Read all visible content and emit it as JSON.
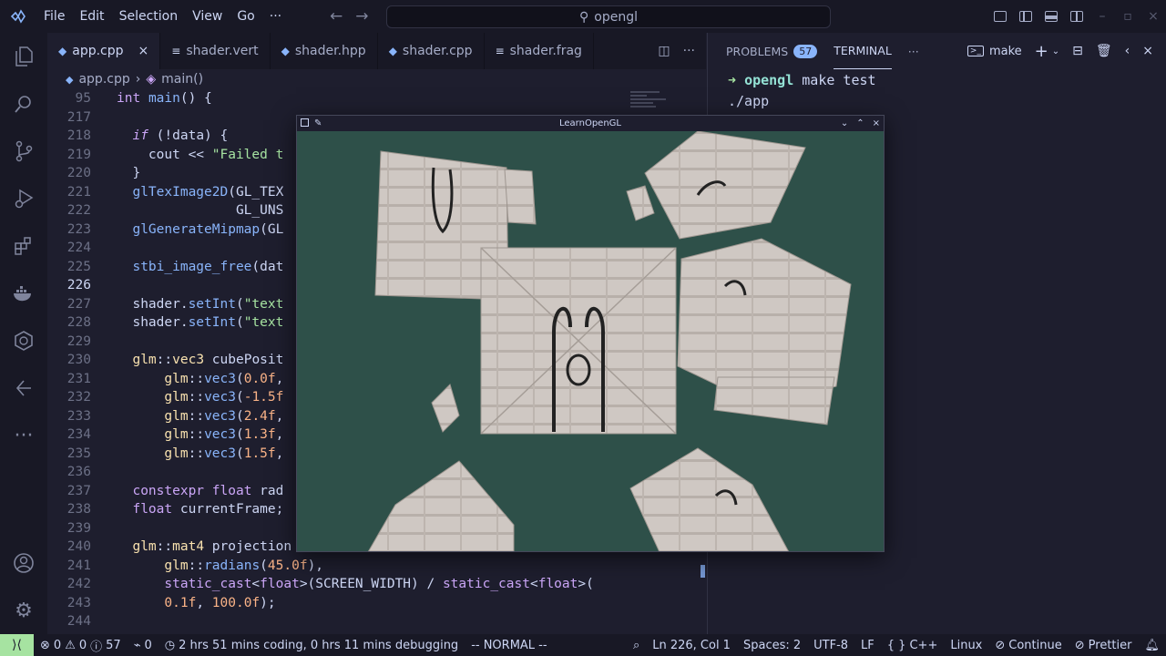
{
  "menu": [
    "File",
    "Edit",
    "Selection",
    "View",
    "Go",
    "···"
  ],
  "search": {
    "text": "opengl"
  },
  "editor": {
    "tabs": [
      {
        "label": "app.cpp",
        "icon": "cpp-icon",
        "active": true
      },
      {
        "label": "shader.vert",
        "icon": "file-lines-icon"
      },
      {
        "label": "shader.hpp",
        "icon": "cpp-icon"
      },
      {
        "label": "shader.cpp",
        "icon": "cpp-icon"
      },
      {
        "label": "shader.frag",
        "icon": "file-lines-icon"
      }
    ],
    "breadcrumb": {
      "file": "app.cpp",
      "symbol": "main()"
    },
    "lines": [
      {
        "n": "95",
        "html": "<span class='kw'>int</span> <span class='fn'>main</span>() {"
      },
      {
        "n": "217",
        "html": ""
      },
      {
        "n": "218",
        "html": "  <span class='it'>if</span> (!data) {"
      },
      {
        "n": "219",
        "html": "    cout << <span class='st'>\"Failed t</span>"
      },
      {
        "n": "220",
        "html": "  }"
      },
      {
        "n": "221",
        "html": "  <span class='fn'>glTexImage2D</span>(GL_TEX"
      },
      {
        "n": "222",
        "html": "               GL_UNS"
      },
      {
        "n": "223",
        "html": "  <span class='fn'>glGenerateMipmap</span>(GL"
      },
      {
        "n": "224",
        "html": ""
      },
      {
        "n": "225",
        "html": "  <span class='fn'>stbi_image_free</span>(dat"
      },
      {
        "n": "226",
        "html": "",
        "current": true
      },
      {
        "n": "227",
        "html": "  shader.<span class='fn'>setInt</span>(<span class='st'>\"text</span>"
      },
      {
        "n": "228",
        "html": "  shader.<span class='fn'>setInt</span>(<span class='st'>\"text</span>"
      },
      {
        "n": "229",
        "html": ""
      },
      {
        "n": "230",
        "html": "  <span class='ty'>glm</span>::<span class='ty'>vec3</span> cubePosit"
      },
      {
        "n": "231",
        "html": "      <span class='ty'>glm</span>::<span class='fn'>vec3</span>(<span class='nm'>0.0f</span>,"
      },
      {
        "n": "232",
        "html": "      <span class='ty'>glm</span>::<span class='fn'>vec3</span>(<span class='nm'>-1.5f</span>"
      },
      {
        "n": "233",
        "html": "      <span class='ty'>glm</span>::<span class='fn'>vec3</span>(<span class='nm'>2.4f</span>,"
      },
      {
        "n": "234",
        "html": "      <span class='ty'>glm</span>::<span class='fn'>vec3</span>(<span class='nm'>1.3f</span>,"
      },
      {
        "n": "235",
        "html": "      <span class='ty'>glm</span>::<span class='fn'>vec3</span>(<span class='nm'>1.5f</span>,"
      },
      {
        "n": "236",
        "html": ""
      },
      {
        "n": "237",
        "html": "  <span class='kw'>constexpr</span> <span class='kw'>float</span> rad"
      },
      {
        "n": "238",
        "html": "  <span class='kw'>float</span> currentFrame;"
      },
      {
        "n": "239",
        "html": ""
      },
      {
        "n": "240",
        "html": "  <span class='ty'>glm</span>::<span class='ty'>mat4</span> projection"
      },
      {
        "n": "241",
        "html": "      <span class='ty'>glm</span>::<span class='fn'>radians</span>(<span class='nm'>45.0f</span>),"
      },
      {
        "n": "242",
        "html": "      <span class='kw'>static_cast</span><<span class='kw'>float</span>>(SCREEN_WIDTH) / <span class='kw'>static_cast</span><<span class='kw'>float</span>>("
      },
      {
        "n": "243",
        "html": "      <span class='nm'>0.1f</span>, <span class='nm'>100.0f</span>);"
      },
      {
        "n": "244",
        "html": ""
      }
    ]
  },
  "panel": {
    "problems_label": "PROBLEMS",
    "problems_count": "57",
    "terminal_label": "TERMINAL",
    "more": "···",
    "shell_name": "make",
    "terminal_lines": [
      {
        "arrow": "➜",
        "dir": "opengl",
        "cmd": "make test"
      },
      {
        "text": "./app"
      }
    ]
  },
  "glwindow": {
    "title": "LearnOpenGL",
    "clear_color": "#2e5049"
  },
  "status": {
    "errors": "0",
    "warnings": "0",
    "info": "57",
    "ports": "0",
    "time": "2 hrs 51 mins coding, 0 hrs 11 mins debugging",
    "mode": "-- NORMAL --",
    "position": "Ln 226, Col 1",
    "spaces": "Spaces: 2",
    "encoding": "UTF-8",
    "eol": "LF",
    "language": "C++",
    "os": "Linux",
    "continue": "Continue",
    "prettier": "Prettier"
  },
  "colors": {
    "accent": "#89b4fa",
    "green": "#a6e3a1",
    "background": "#1e1e2e"
  }
}
